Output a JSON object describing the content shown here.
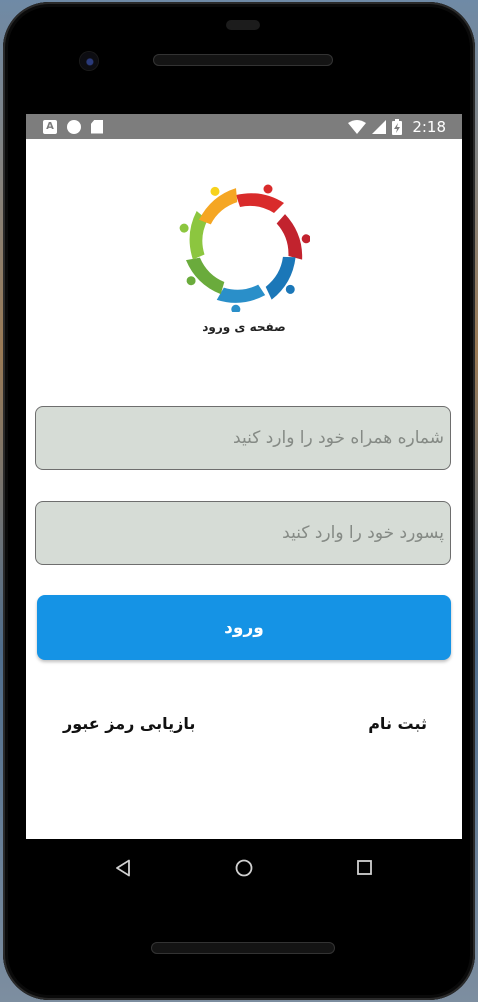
{
  "status_bar": {
    "notification_icons": [
      "a-notification-icon",
      "circle-notification-icon",
      "sd-card-icon"
    ],
    "system_icons": [
      "wifi-icon",
      "signal-icon",
      "battery-charging-icon"
    ],
    "time": "2:18"
  },
  "logo": {
    "icon": "people-circle-logo",
    "colors": [
      "#d92b2b",
      "#1b77b8",
      "#6aab3c",
      "#f5a623",
      "#f7d21c"
    ],
    "caption": "صفحه ی ورود"
  },
  "form": {
    "phone_placeholder": "شماره همراه خود را وارد کنید",
    "password_placeholder": "پسورد خود را وارد کنید",
    "login_label": "ورود"
  },
  "links": {
    "register": "ثبت نام",
    "forgot_password": "بازیابی رمز عبور"
  },
  "nav_bar": {
    "icons": [
      "back-triangle-icon",
      "home-circle-icon",
      "recents-square-icon"
    ]
  },
  "colors": {
    "accent": "#1593e5",
    "field_background": "#d6dcd6",
    "status_bar": "#7d7d7d"
  }
}
